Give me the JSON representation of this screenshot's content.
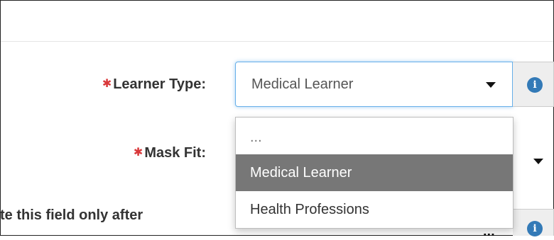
{
  "form": {
    "learner_type": {
      "required_mark": "✱",
      "label": "Learner Type:",
      "selected": "Medical Learner",
      "options": [
        "...",
        "Medical Learner",
        "Health Professions"
      ],
      "info_glyph": "i"
    },
    "mask_fit": {
      "required_mark": "✱",
      "label": "Mask Fit:"
    },
    "third_field": {
      "label": "te this field only after",
      "trigger_text": "...",
      "info_glyph": "i"
    }
  },
  "colors": {
    "required": "#d9383a",
    "focus_border": "#66afe9",
    "info_icon": "#337ab7",
    "highlighted_option": "#777777"
  },
  "icons": {
    "dropdown": "caret-down-icon",
    "info": "info-circle-icon"
  }
}
